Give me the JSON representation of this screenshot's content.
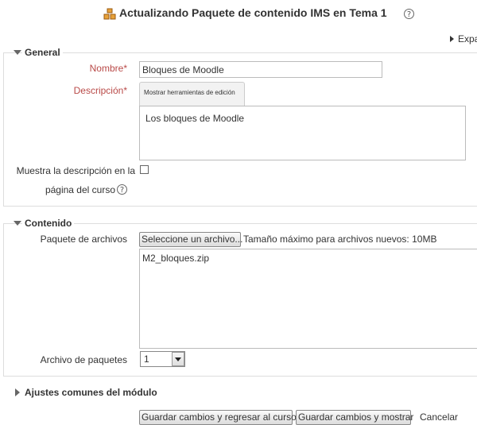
{
  "header": {
    "title": "Actualizando Paquete de contenido IMS en Tema 1",
    "title_icon": "package-icon",
    "help_icon": "help-icon",
    "help_glyph": "?"
  },
  "toolbar": {
    "expand_all": "Expa"
  },
  "general": {
    "legend": "General",
    "name_label": "Nombre",
    "name_value": "Bloques de Moodle",
    "description_label": "Descripción",
    "required_mark": "*",
    "editor_toggle": "Mostrar herramientas de edición",
    "description_value": "Los bloques de Moodle",
    "show_desc_label_1": "Muestra la descripción en la",
    "show_desc_label_2": "página del curso",
    "show_desc_checked": false
  },
  "content": {
    "legend": "Contenido",
    "package_label": "Paquete de archivos",
    "choose_file_button": "Seleccione un archivo...",
    "max_size": "Tamaño máximo para archivos nuevos: 10MB",
    "file_name": "M2_bloques.zip",
    "package_select_label": "Archivo de paquetes",
    "package_select_value": "1"
  },
  "common_settings": {
    "legend": "Ajustes comunes del módulo"
  },
  "actions": {
    "save_return": "Guardar cambios y regresar al curso",
    "save_display": "Guardar cambios y mostrar",
    "cancel": "Cancelar"
  },
  "colors": {
    "required": "#b94a48",
    "border": "#dddddd",
    "text": "#333333"
  }
}
